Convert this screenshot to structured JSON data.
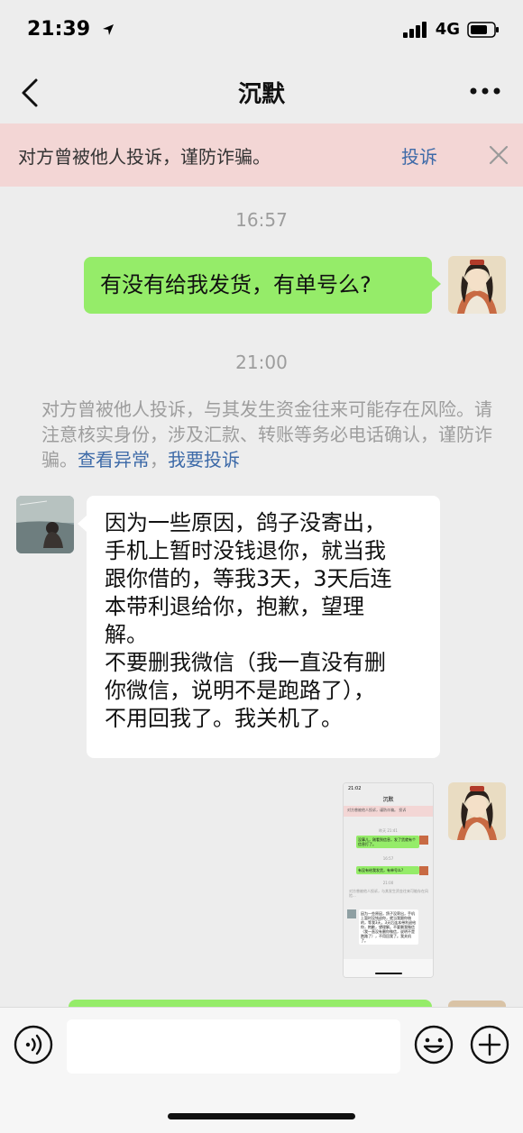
{
  "status_bar": {
    "time": "21:39",
    "network": "4G"
  },
  "nav": {
    "title": "沉默"
  },
  "banner": {
    "text": "对方曾被他人投诉，谨防诈骗。",
    "link": "投诉"
  },
  "messages": {
    "time1": "16:57",
    "msg1": "有没有给我发货，有单号么?",
    "time2": "21:00",
    "system_note": {
      "text": "对方曾被他人投诉，与其发生资金往来可能存在风险。请注意核实身份，涉及汇款、转账等务必电话确认，谨防诈骗。",
      "link1": "查看异常",
      "separator": "，",
      "link2": "我要投诉"
    },
    "msg2": "因为一些原因，鸽子没寄出，\n手机上暂时没钱退你，就当我\n跟你借的，等我3天，3天后连\n本带利退给你，抱歉，望理\n解。\n不要删我微信（我一直没有删\n你微信，说明不是跑路了），\n不用回我了。我关机了。"
  },
  "thumbnail": {
    "time": "21:02",
    "title": "沉默",
    "banner": "对方曾被他人投诉，谨防诈骗。 投诉",
    "t1": "昨天 21:41",
    "m1": "没事儿，刚看到信息，发了货就有个信息打了。",
    "t2": "16:57",
    "m2": "有没有给我发货，有单号么?",
    "t3": "21:00",
    "sys": "对方曾被他人投诉，与其发生资金往来可能存在风险...",
    "m3": "因为一些原因，鸽子没寄出，手机上暂时没钱退你，就当我跟你借的，等我3天，3天后连本带利退给你，抱歉，望理解。不要删我微信（我一直没有删你微信，说明不是跑路了），不用回我了。我关机了。"
  },
  "input_bar": {
    "placeholder": ""
  },
  "colors": {
    "bubble_sent": "#95ec69",
    "bubble_received": "#ffffff",
    "link": "#3d6aa8",
    "banner_bg": "#f3d6d5"
  }
}
